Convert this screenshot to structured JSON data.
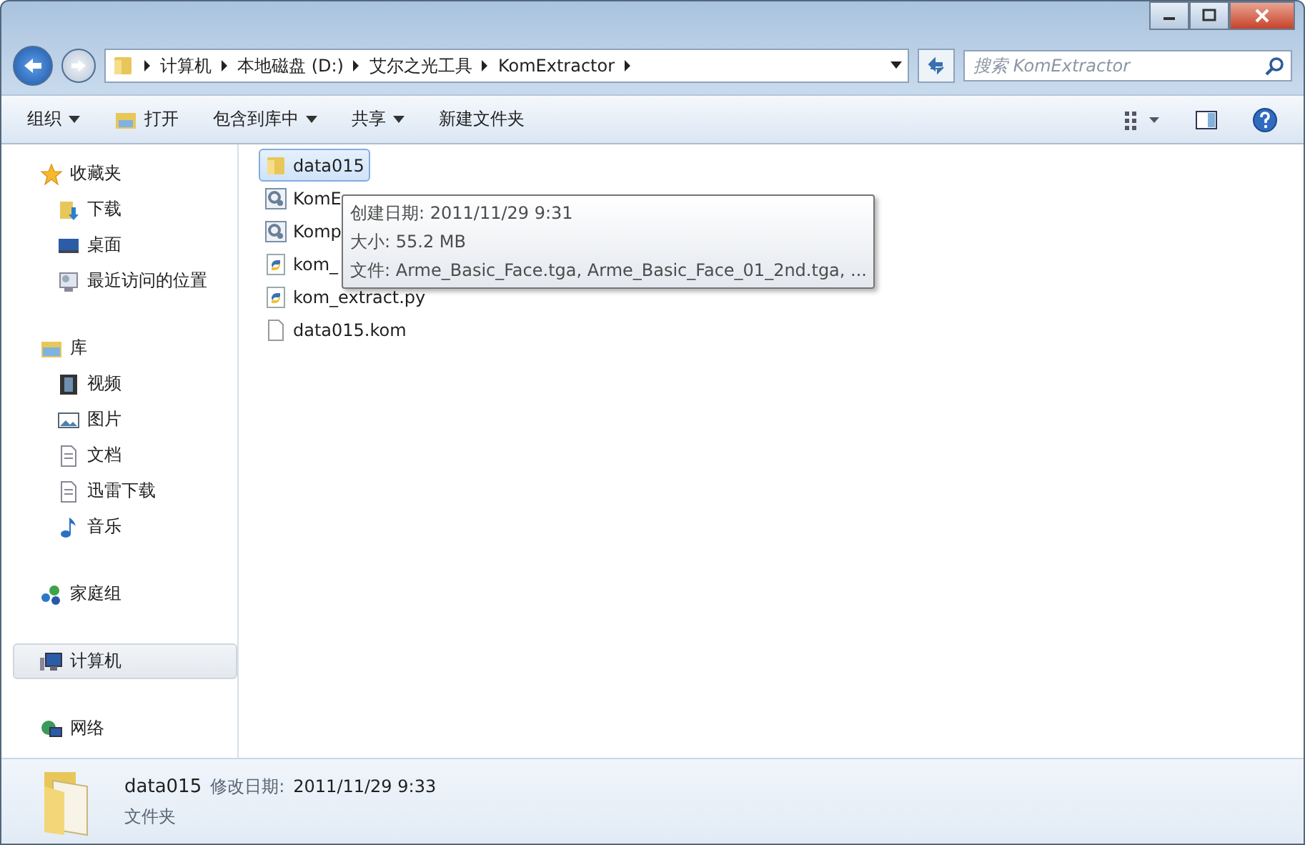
{
  "address_bar": {
    "crumbs": [
      "计算机",
      "本地磁盘 (D:)",
      "艾尔之光工具",
      "KomExtractor"
    ]
  },
  "search": {
    "placeholder": "搜索 KomExtractor"
  },
  "toolbar": {
    "items": [
      {
        "label": "组织",
        "dropdown": true,
        "kind": "plain"
      },
      {
        "label": "打开",
        "dropdown": false,
        "kind": "open"
      },
      {
        "label": "包含到库中",
        "dropdown": true,
        "kind": "plain"
      },
      {
        "label": "共享",
        "dropdown": true,
        "kind": "plain"
      },
      {
        "label": "新建文件夹",
        "dropdown": false,
        "kind": "plain"
      }
    ]
  },
  "sidebar": {
    "items": [
      {
        "label": "收藏夹",
        "kind": "star",
        "selected": false,
        "children": [
          {
            "label": "下载",
            "kind": "download",
            "selected": false
          },
          {
            "label": "桌面",
            "kind": "desktop",
            "selected": false
          },
          {
            "label": "最近访问的位置",
            "kind": "recent",
            "selected": false
          }
        ]
      },
      {
        "label": "库",
        "kind": "library",
        "selected": false,
        "children": [
          {
            "label": "视频",
            "kind": "video",
            "selected": false
          },
          {
            "label": "图片",
            "kind": "picture",
            "selected": false
          },
          {
            "label": "文档",
            "kind": "doc",
            "selected": false
          },
          {
            "label": "迅雷下载",
            "kind": "doc",
            "selected": false
          },
          {
            "label": "音乐",
            "kind": "music",
            "selected": false
          }
        ]
      },
      {
        "label": "家庭组",
        "kind": "homegroup",
        "selected": false
      },
      {
        "label": "计算机",
        "kind": "computer",
        "selected": true
      },
      {
        "label": "网络",
        "kind": "network",
        "selected": false
      }
    ]
  },
  "files": [
    {
      "name": "data015",
      "kind": "folder",
      "selected": true
    },
    {
      "name": "KomE",
      "kind": "app",
      "selected": false
    },
    {
      "name": "Komp",
      "kind": "app",
      "selected": false
    },
    {
      "name": "kom_",
      "kind": "python",
      "selected": false
    },
    {
      "name": "kom_extract.py",
      "kind": "python",
      "selected": false
    },
    {
      "name": "data015.kom",
      "kind": "file",
      "selected": false
    }
  ],
  "tooltip": {
    "lines": [
      "创建日期: 2011/11/29 9:31",
      "大小: 55.2 MB",
      "文件: Arme_Basic_Face.tga, Arme_Basic_Face_01_2nd.tga, ..."
    ]
  },
  "details": {
    "name": "data015",
    "label": "修改日期:",
    "value": "2011/11/29 9:33",
    "type": "文件夹"
  }
}
